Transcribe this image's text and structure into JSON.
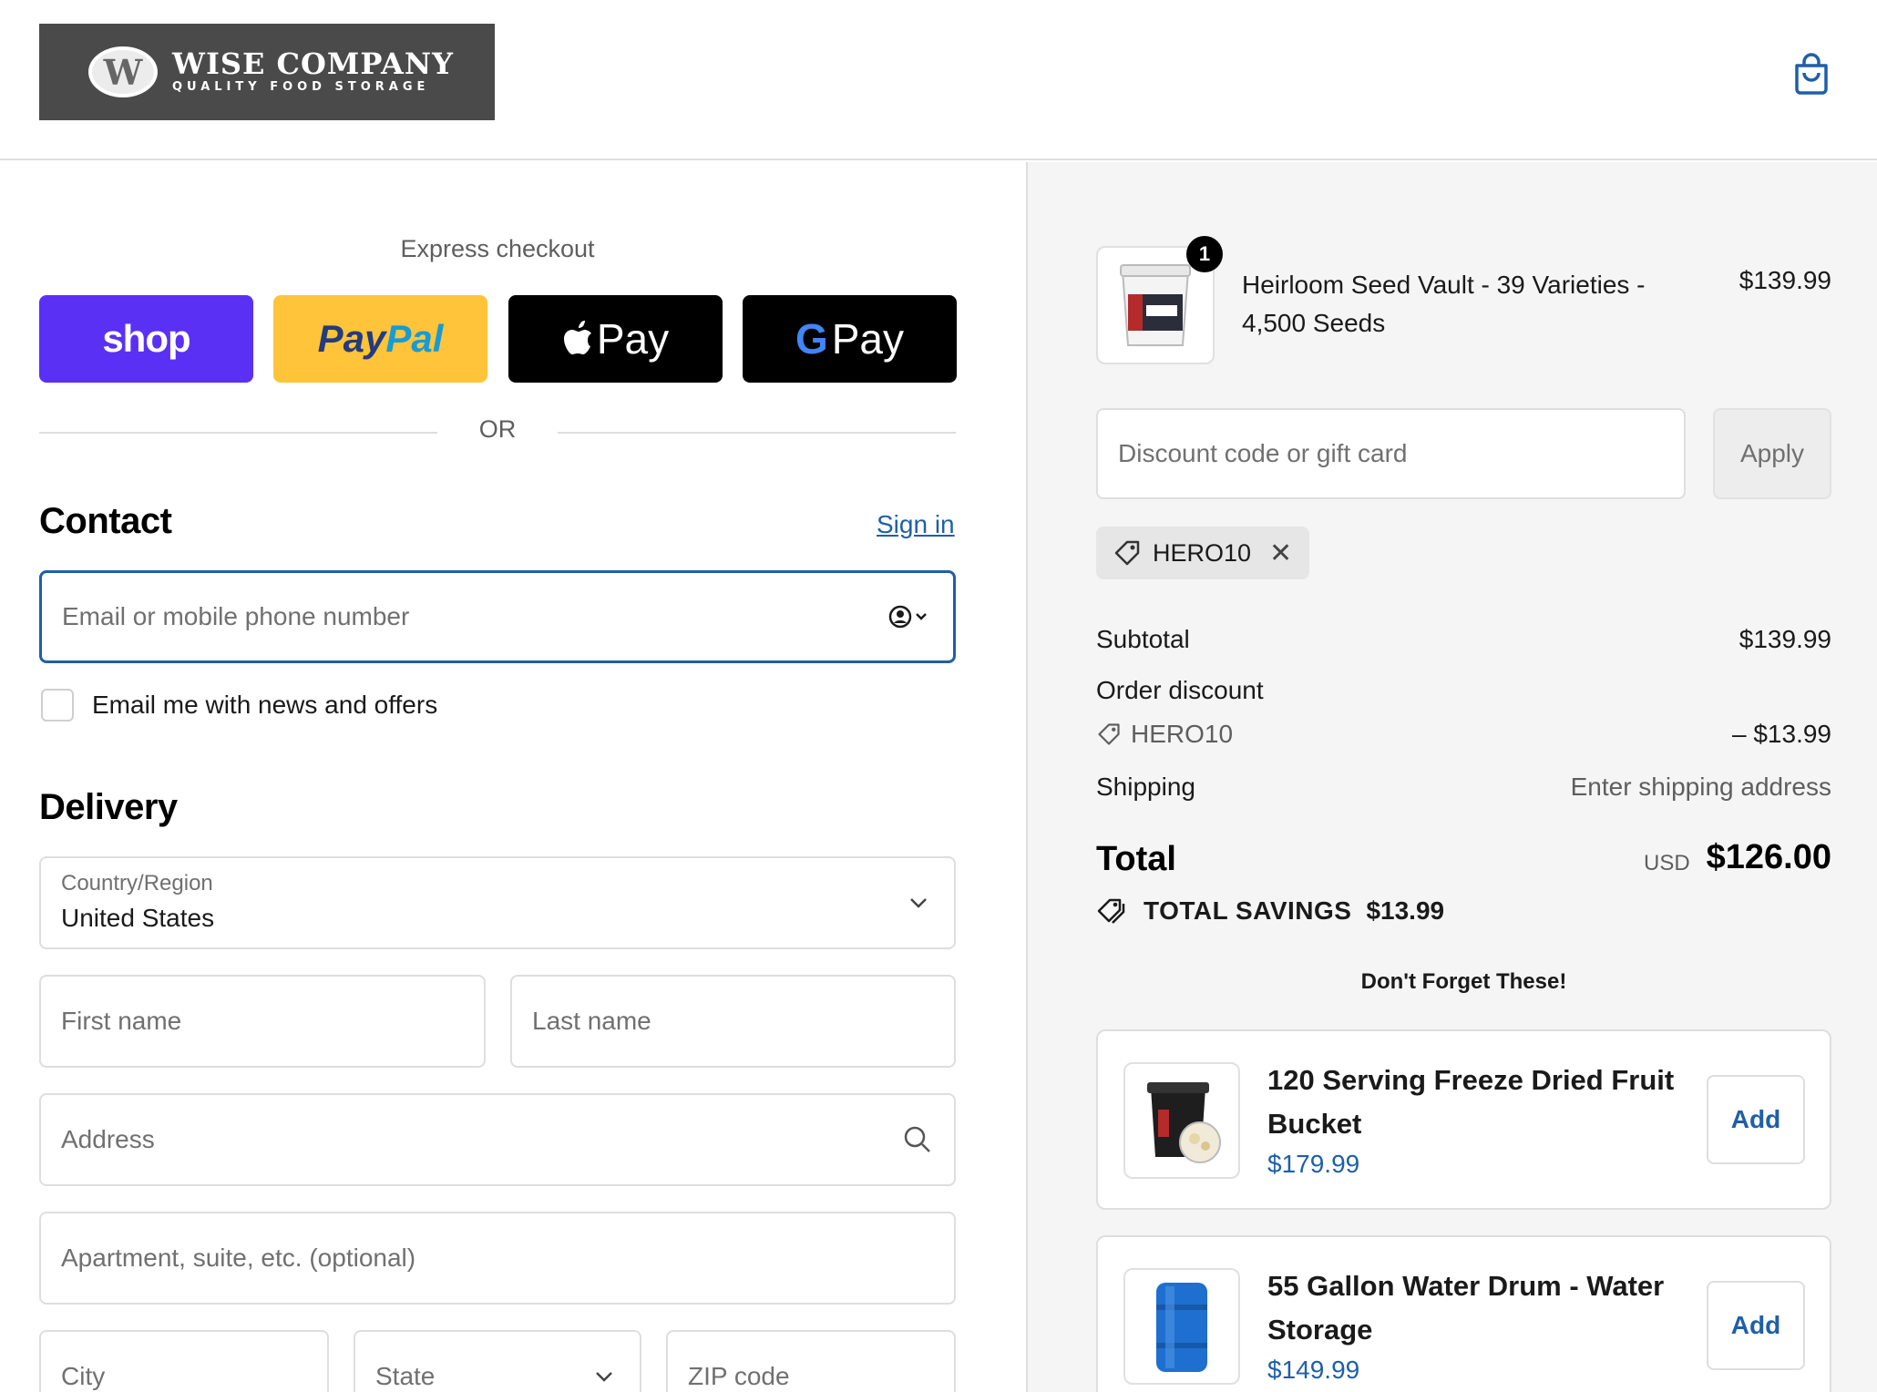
{
  "header": {
    "logo_name": "WISE COMPANY",
    "logo_tagline": "QUALITY FOOD STORAGE",
    "logo_badge_letter": "W",
    "cart_icon": "shopping-bag-icon"
  },
  "express": {
    "label": "Express checkout",
    "shop_label": "shop",
    "paypal_part1": "Pay",
    "paypal_part2": "Pal",
    "apple_label": "Pay",
    "gpay_g": "G",
    "gpay_label": "Pay",
    "or_label": "OR"
  },
  "contact": {
    "title": "Contact",
    "sign_in": "Sign in",
    "email_placeholder": "Email or mobile phone number",
    "news_label": "Email me with news and offers",
    "news_checked": false
  },
  "delivery": {
    "title": "Delivery",
    "country_label": "Country/Region",
    "country_value": "United States",
    "first_name_placeholder": "First name",
    "last_name_placeholder": "Last name",
    "address_placeholder": "Address",
    "apartment_placeholder": "Apartment, suite, etc. (optional)",
    "city_placeholder": "City",
    "state_placeholder": "State",
    "zip_placeholder": "ZIP code"
  },
  "order": {
    "item": {
      "quantity": "1",
      "name": "Heirloom Seed Vault - 39 Varieties - 4,500 Seeds",
      "price": "$139.99"
    },
    "discount_placeholder": "Discount code or gift card",
    "apply_label": "Apply",
    "applied_code": "HERO10",
    "subtotal_label": "Subtotal",
    "subtotal_value": "$139.99",
    "order_discount_label": "Order discount",
    "discount_code": "HERO10",
    "discount_value": "– $13.99",
    "shipping_label": "Shipping",
    "shipping_value": "Enter shipping address",
    "total_label": "Total",
    "total_currency": "USD",
    "total_value": "$126.00",
    "savings_label": "TOTAL SAVINGS",
    "savings_value": "$13.99"
  },
  "upsell": {
    "title": "Don't Forget These!",
    "items": [
      {
        "name": "120 Serving Freeze Dried Fruit Bucket",
        "price": "$179.99",
        "add_label": "Add"
      },
      {
        "name": "55 Gallon Water Drum - Water Storage",
        "price": "$149.99",
        "add_label": "Add"
      }
    ]
  },
  "colors": {
    "accent": "#1f5fa8",
    "shop_pay": "#5a31f4",
    "paypal": "#ffc439",
    "sidebar_bg": "#f5f5f5"
  }
}
